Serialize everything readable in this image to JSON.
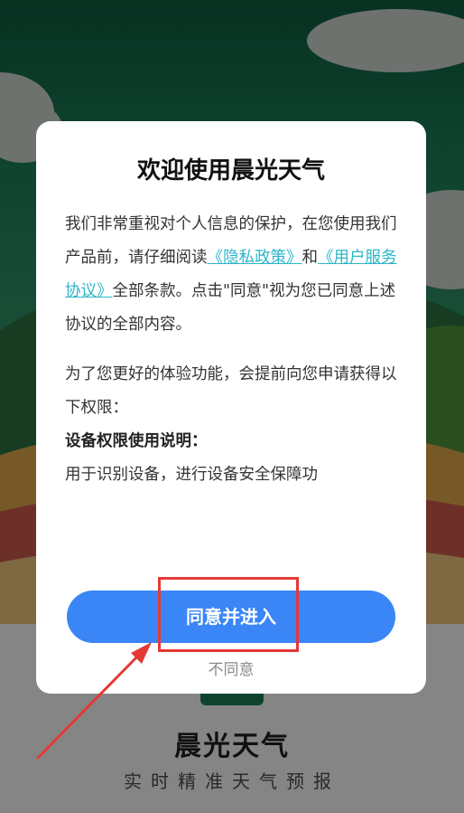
{
  "dialog": {
    "title": "欢迎使用晨光天气",
    "p1_a": "我们非常重视对个人信息的保护，在您使用我们产品前，请仔细阅读",
    "privacy_link": "《隐私政策》",
    "p1_and": "和",
    "terms_link": "《用户服务协议》",
    "p1_b": "全部条款。点击\"同意\"视为您已同意上述协议的全部内容。",
    "p2": "为了您更好的体验功能，会提前向您申请获得以下权限：",
    "p3_heading": "设备权限使用说明：",
    "p3": "用于识别设备，进行设备安全保障功",
    "agree_label": "同意并进入",
    "disagree_label": "不同意"
  },
  "background": {
    "app_name": "晨光天气",
    "slogan": "实时精准天气预报"
  },
  "colors": {
    "agree_button": "#3a86f7",
    "link": "#2bb6c9",
    "highlight": "#e53935"
  }
}
